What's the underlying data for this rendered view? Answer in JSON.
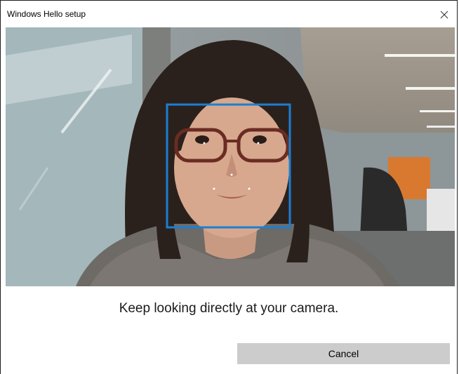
{
  "window": {
    "title": "Windows Hello setup",
    "close_icon": "close-icon"
  },
  "camera_feed": {
    "face_detected": true,
    "frame_color": "#1a7fd4"
  },
  "message": "Keep looking directly at your camera.",
  "cancel_label": "Cancel"
}
